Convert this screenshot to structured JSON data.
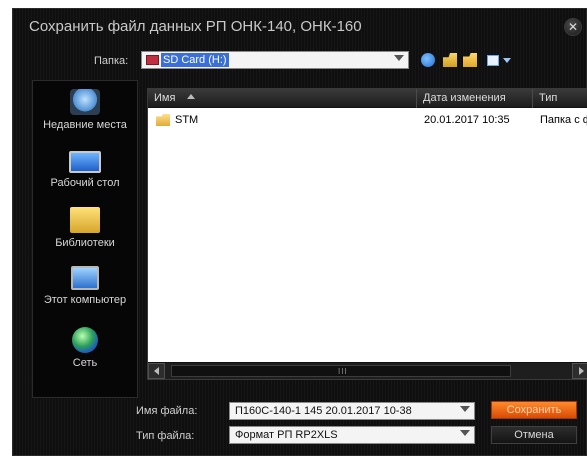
{
  "window": {
    "title": "Сохранить файл данных РП ОНК-140, ОНК-160",
    "close_glyph": "✕"
  },
  "folder_row": {
    "label": "Папка:",
    "selected": "SD Card (H:)"
  },
  "places": [
    {
      "label": "Недавние места",
      "icon": "recent-places-icon"
    },
    {
      "label": "Рабочий стол",
      "icon": "desktop-icon"
    },
    {
      "label": "Библиотеки",
      "icon": "libraries-icon"
    },
    {
      "label": "Этот компьютер",
      "icon": "computer-icon"
    },
    {
      "label": "Сеть",
      "icon": "network-icon"
    }
  ],
  "file_list": {
    "columns": [
      "Имя",
      "Дата изменения",
      "Тип"
    ],
    "rows": [
      {
        "name": "STM",
        "date": "20.01.2017 10:35",
        "type": "Папка с ф"
      }
    ],
    "scroll_grip": "III"
  },
  "bottom": {
    "filename_label": "Имя файла:",
    "filename_value": "П160С-140-1 145 20.01.2017 10-38",
    "filetype_label": "Тип файла:",
    "filetype_value": "Формат РП RP2XLS",
    "save_label": "Сохранить",
    "cancel_label": "Отмена"
  },
  "colors": {
    "dialog_bg": "#0f0f0f",
    "accent_orange": "#e05a0c",
    "selection_blue": "#3a6fd8"
  }
}
